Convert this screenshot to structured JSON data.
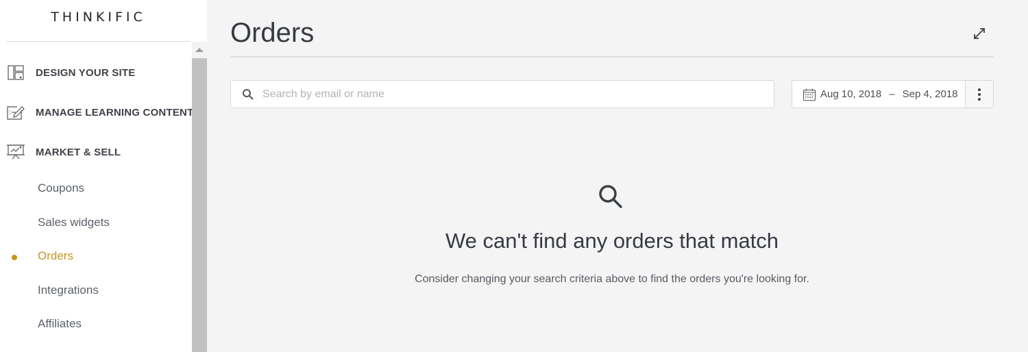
{
  "sidebar": {
    "logo": "THINKIFIC",
    "sections": [
      {
        "label": "DESIGN YOUR SITE",
        "icon": "layout-icon"
      },
      {
        "label": "MANAGE LEARNING CONTENT",
        "icon": "edit-content-icon"
      },
      {
        "label": "MARKET & SELL",
        "icon": "presentation-chart-icon"
      }
    ],
    "sub_items": [
      {
        "label": "Coupons",
        "active": false
      },
      {
        "label": "Sales widgets",
        "active": false
      },
      {
        "label": "Orders",
        "active": true
      },
      {
        "label": "Integrations",
        "active": false
      },
      {
        "label": "Affiliates",
        "active": false
      }
    ],
    "accent_color": "#c8951f"
  },
  "main": {
    "title": "Orders",
    "search": {
      "placeholder": "Search by email or name",
      "value": ""
    },
    "date_range": {
      "start": "Aug 10, 2018",
      "separator": "–",
      "end": "Sep 4, 2018"
    },
    "empty_state": {
      "title": "We can't find any orders that match",
      "message": "Consider changing your search criteria above to find the orders you're looking for."
    }
  }
}
